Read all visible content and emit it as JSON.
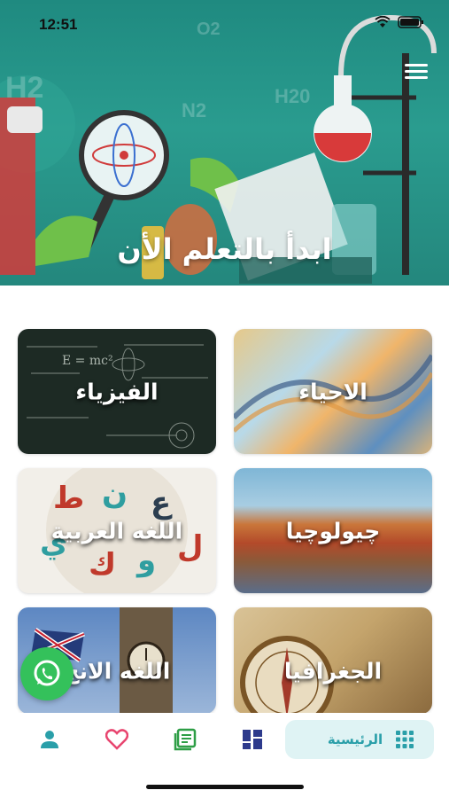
{
  "status": {
    "time": "12:51"
  },
  "hero": {
    "title": "ابدأ بالتعلم الأن",
    "formulas": [
      "O2",
      "N2",
      "H20",
      "H2"
    ]
  },
  "subjects": [
    {
      "label": "الاحياء",
      "theme": "biology"
    },
    {
      "label": "الفيزياء",
      "theme": "physics"
    },
    {
      "label": "چيولوچيا",
      "theme": "geology"
    },
    {
      "label": "اللغه العربية",
      "theme": "arabic"
    },
    {
      "label": "الجغرافيا",
      "theme": "geography"
    },
    {
      "label": "اللغه الانج",
      "theme": "english"
    }
  ],
  "physics_formula": "E = mc²",
  "nav": {
    "home_label": "الرئيسية",
    "accent": "#2a9fa9",
    "items": [
      "grid-icon",
      "dashboard-icon",
      "courses-icon",
      "favorites-icon",
      "profile-icon"
    ]
  },
  "colors": {
    "teal": "#1f8a80",
    "whatsapp": "#34c15b",
    "favorite": "#e8456f",
    "courses": "#2e9e46",
    "dashboard": "#2d3a8c"
  }
}
